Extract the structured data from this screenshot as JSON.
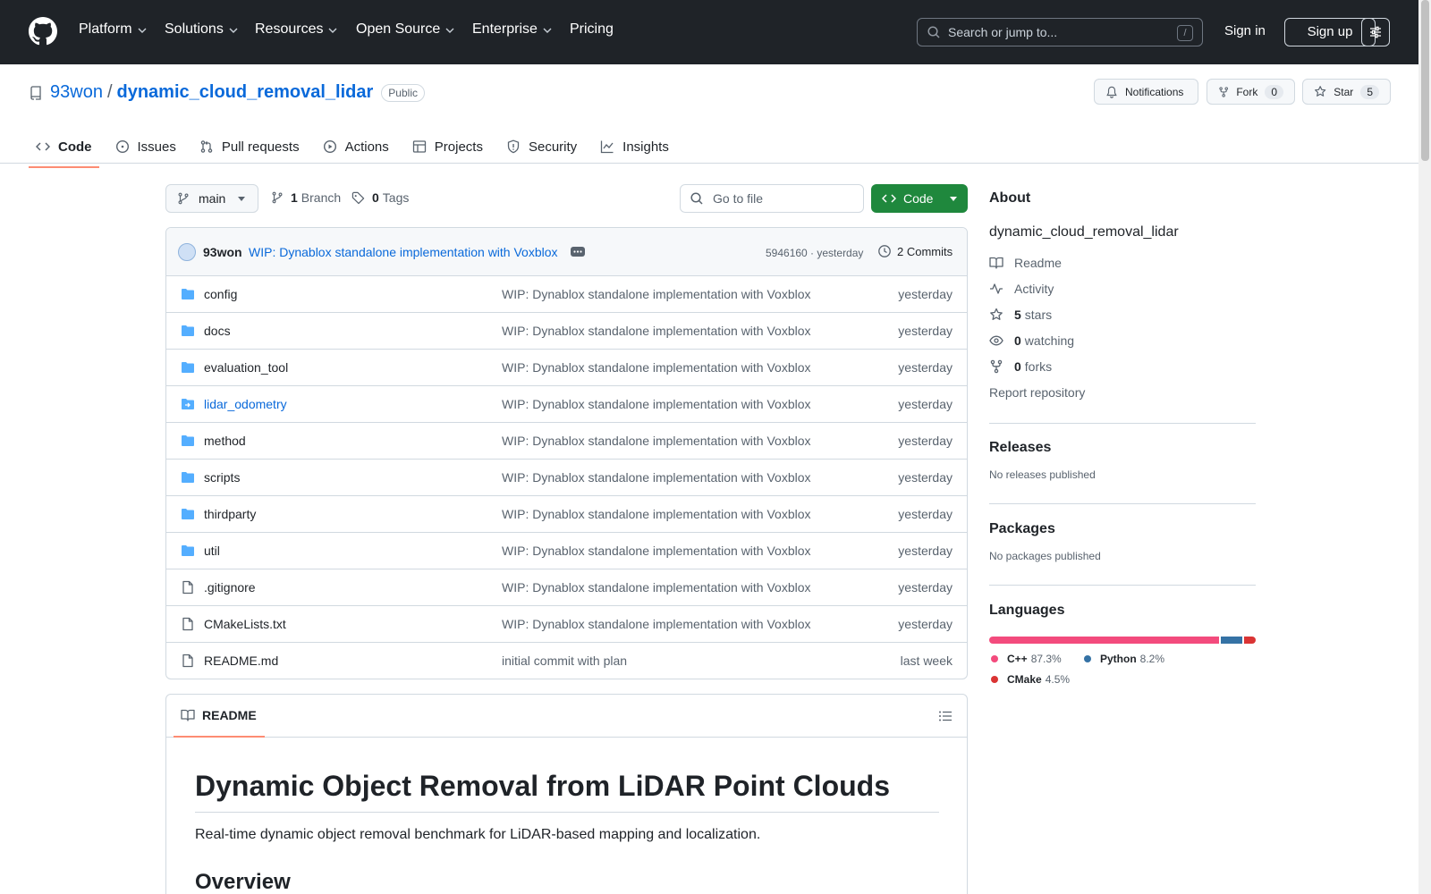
{
  "header": {
    "nav": [
      {
        "label": "Platform"
      },
      {
        "label": "Solutions"
      },
      {
        "label": "Resources"
      },
      {
        "label": "Open Source"
      },
      {
        "label": "Enterprise"
      },
      {
        "label": "Pricing"
      }
    ],
    "search_placeholder": "Search or jump to...",
    "search_shortcut": "/",
    "sign_in": "Sign in",
    "sign_up": "Sign up"
  },
  "repo": {
    "owner": "93won",
    "name": "dynamic_cloud_removal_lidar",
    "visibility": "Public",
    "notifications_label": "Notifications",
    "fork_label": "Fork",
    "fork_count": "0",
    "star_label": "Star",
    "star_count": "5"
  },
  "tabs": [
    {
      "label": "Code",
      "icon": "code-icon",
      "active": true
    },
    {
      "label": "Issues",
      "icon": "issue-icon"
    },
    {
      "label": "Pull requests",
      "icon": "pull-request-icon"
    },
    {
      "label": "Actions",
      "icon": "play-icon"
    },
    {
      "label": "Projects",
      "icon": "table-icon"
    },
    {
      "label": "Security",
      "icon": "shield-icon"
    },
    {
      "label": "Insights",
      "icon": "graph-icon"
    }
  ],
  "toolbar": {
    "branch": "main",
    "branch_count": "1",
    "branch_label": "Branch",
    "tag_count": "0",
    "tag_label": "Tags",
    "goto_placeholder": "Go to file",
    "code_button": "Code"
  },
  "latest_commit": {
    "author": "93won",
    "message": "WIP: Dynablox standalone implementation with Voxblox",
    "sha": "5946160",
    "time": "yesterday",
    "sha_time": "5946160 · yesterday",
    "commits": "2 Commits"
  },
  "files": [
    {
      "name": "config",
      "type": "dir",
      "message": "WIP: Dynablox standalone implementation with Voxblox",
      "date": "yesterday"
    },
    {
      "name": "docs",
      "type": "dir",
      "message": "WIP: Dynablox standalone implementation with Voxblox",
      "date": "yesterday"
    },
    {
      "name": "evaluation_tool",
      "type": "dir",
      "message": "WIP: Dynablox standalone implementation with Voxblox",
      "date": "yesterday"
    },
    {
      "name": "lidar_odometry",
      "type": "submodule",
      "message": "WIP: Dynablox standalone implementation with Voxblox",
      "date": "yesterday"
    },
    {
      "name": "method",
      "type": "dir",
      "message": "WIP: Dynablox standalone implementation with Voxblox",
      "date": "yesterday"
    },
    {
      "name": "scripts",
      "type": "dir",
      "message": "WIP: Dynablox standalone implementation with Voxblox",
      "date": "yesterday"
    },
    {
      "name": "thirdparty",
      "type": "dir",
      "message": "WIP: Dynablox standalone implementation with Voxblox",
      "date": "yesterday"
    },
    {
      "name": "util",
      "type": "dir",
      "message": "WIP: Dynablox standalone implementation with Voxblox",
      "date": "yesterday"
    },
    {
      "name": ".gitignore",
      "type": "file",
      "message": "WIP: Dynablox standalone implementation with Voxblox",
      "date": "yesterday"
    },
    {
      "name": "CMakeLists.txt",
      "type": "file",
      "message": "WIP: Dynablox standalone implementation with Voxblox",
      "date": "yesterday"
    },
    {
      "name": "README.md",
      "type": "file",
      "message": "initial commit with plan",
      "date": "last week"
    }
  ],
  "readme": {
    "tab_label": "README",
    "title": "Dynamic Object Removal from LiDAR Point Clouds",
    "lead": "Real-time dynamic object removal benchmark for LiDAR-based mapping and localization.",
    "h2": "Overview"
  },
  "about": {
    "heading": "About",
    "description": "dynamic_cloud_removal_lidar",
    "readme": "Readme",
    "activity": "Activity",
    "stars_count": "5",
    "stars_label": "stars",
    "watching_count": "0",
    "watching_label": "watching",
    "forks_count": "0",
    "forks_label": "forks",
    "report": "Report repository"
  },
  "releases": {
    "heading": "Releases",
    "empty": "No releases published"
  },
  "packages": {
    "heading": "Packages",
    "empty": "No packages published"
  },
  "languages": {
    "heading": "Languages",
    "items": [
      {
        "name": "C++",
        "percent": "87.3%",
        "value": 87.3,
        "color": "#f34b7d"
      },
      {
        "name": "Python",
        "percent": "8.2%",
        "value": 8.2,
        "color": "#3572A5"
      },
      {
        "name": "CMake",
        "percent": "4.5%",
        "value": 4.5,
        "color": "#DA3434"
      }
    ]
  }
}
